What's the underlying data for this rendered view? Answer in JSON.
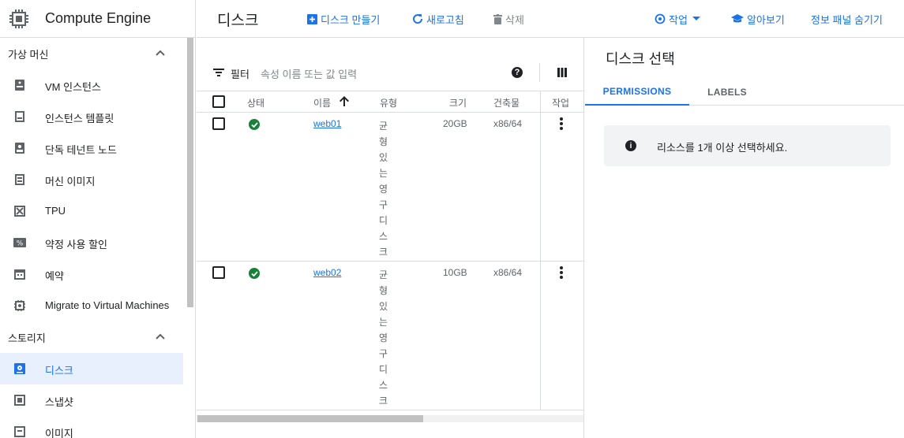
{
  "app": {
    "product": "Compute Engine"
  },
  "nav": {
    "sections": [
      {
        "label": "가상 머신"
      },
      {
        "label": "스토리지"
      }
    ],
    "vm_items": [
      {
        "label": "VM 인스턴스",
        "icon": "vm-instance-icon"
      },
      {
        "label": "인스턴스 템플릿",
        "icon": "instance-template-icon"
      },
      {
        "label": "단독 테넌트 노드",
        "icon": "sole-tenant-node-icon"
      },
      {
        "label": "머신 이미지",
        "icon": "machine-image-icon"
      },
      {
        "label": "TPU",
        "icon": "tpu-icon"
      },
      {
        "label": "약정 사용 할인",
        "icon": "committed-use-discount-icon"
      },
      {
        "label": "예약",
        "icon": "reservation-icon"
      },
      {
        "label": "Migrate to Virtual Machines",
        "icon": "migrate-icon"
      }
    ],
    "storage_items": [
      {
        "label": "디스크",
        "icon": "disk-icon",
        "active": true
      },
      {
        "label": "스냅샷",
        "icon": "snapshot-icon"
      },
      {
        "label": "이미지",
        "icon": "image-icon"
      }
    ]
  },
  "toolbar": {
    "title": "디스크",
    "create": "디스크 만들기",
    "refresh": "새로고침",
    "delete": "삭제",
    "actions": "작업",
    "learn": "알아보기",
    "hide_panel": "정보 패널 숨기기"
  },
  "filter": {
    "label": "필터",
    "placeholder": "속성 이름 또는 값 입력"
  },
  "table": {
    "headers": {
      "status": "상태",
      "name": "이름",
      "type": "유형",
      "size": "크기",
      "arch": "건축물",
      "actions": "작업"
    },
    "rows": [
      {
        "name": "web01",
        "type": "균형있는영구디스크",
        "size": "20GB",
        "arch": "x86/64"
      },
      {
        "name": "web02",
        "type": "균형있는영구디스크",
        "size": "10GB",
        "arch": "x86/64"
      }
    ]
  },
  "panel": {
    "title": "디스크 선택",
    "tabs": [
      "PERMISSIONS",
      "LABELS"
    ],
    "info": "리소스를 1개 이상 선택하세요."
  },
  "colors": {
    "accent": "#1a73e8",
    "status_ok": "#188038",
    "active_bg": "#e8f0fe"
  }
}
